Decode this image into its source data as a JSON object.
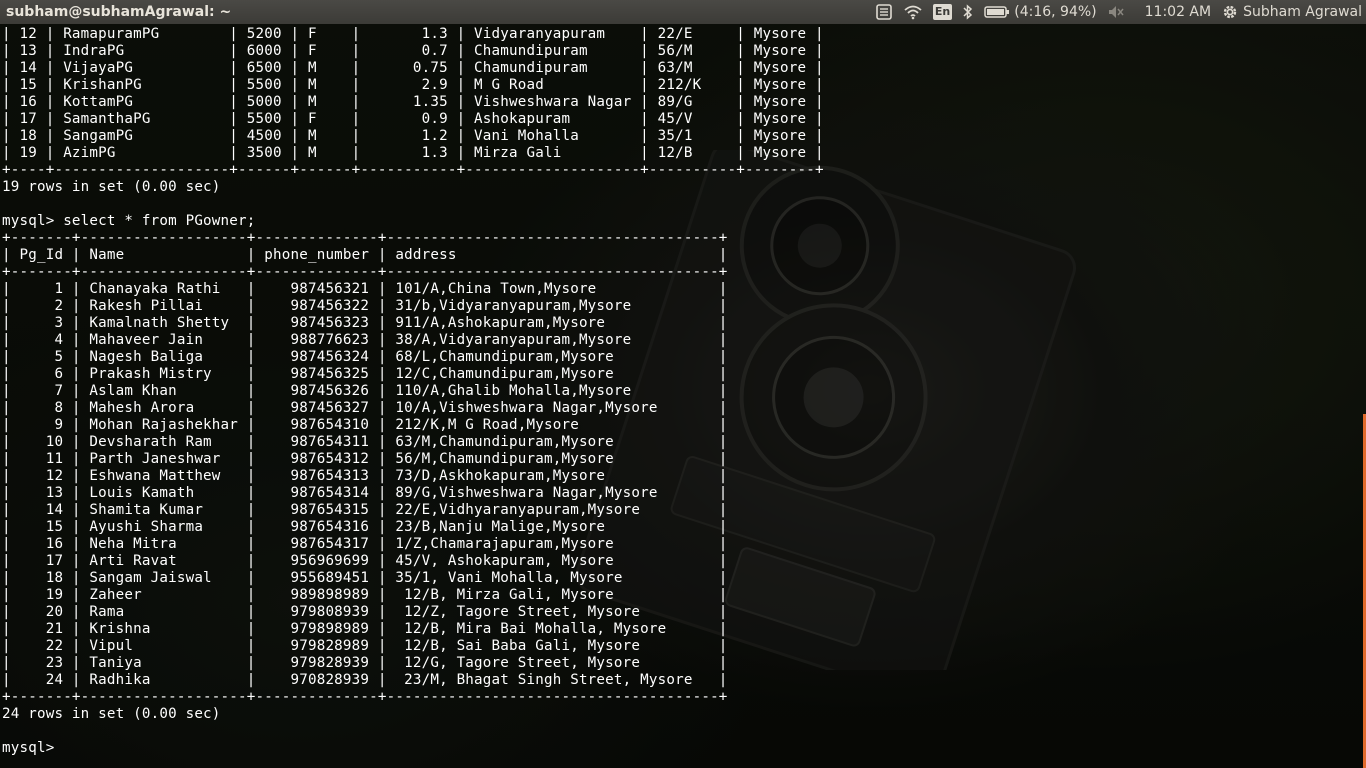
{
  "topbar": {
    "window_title": "subham@subhamAgrawal: ~",
    "language": "En",
    "battery": "(4:16, 94%)",
    "clock": "11:02 AM",
    "user": "Subham Agrawal"
  },
  "terminal": {
    "lines": [
      "| 12 | RamapuramPG        | 5200 | F    |       1.3 | Vidyaranyapuram    | 22/E     | Mysore |",
      "| 13 | IndraPG            | 6000 | F    |       0.7 | Chamundipuram      | 56/M     | Mysore |",
      "| 14 | VijayaPG           | 6500 | M    |      0.75 | Chamundipuram      | 63/M     | Mysore |",
      "| 15 | KrishanPG          | 5500 | M    |       2.9 | M G Road           | 212/K    | Mysore |",
      "| 16 | KottamPG           | 5000 | M    |      1.35 | Vishweshwara Nagar | 89/G     | Mysore |",
      "| 17 | SamanthaPG         | 5500 | F    |       0.9 | Ashokapuram        | 45/V     | Mysore |",
      "| 18 | SangamPG           | 4500 | M    |       1.2 | Vani Mohalla       | 35/1     | Mysore |",
      "| 19 | AzimPG             | 3500 | M    |       1.3 | Mirza Gali         | 12/B     | Mysore |",
      "+----+--------------------+------+------+-----------+--------------------+----------+--------+",
      "19 rows in set (0.00 sec)",
      "",
      "mysql> select * from PGowner;",
      "+-------+-------------------+--------------+--------------------------------------+",
      "| Pg_Id | Name              | phone_number | address                              |",
      "+-------+-------------------+--------------+--------------------------------------+",
      "|     1 | Chanayaka Rathi   |    987456321 | 101/A,China Town,Mysore              |",
      "|     2 | Rakesh Pillai     |    987456322 | 31/b,Vidyaranyapuram,Mysore          |",
      "|     3 | Kamalnath Shetty  |    987456323 | 911/A,Ashokapuram,Mysore             |",
      "|     4 | Mahaveer Jain     |    988776623 | 38/A,Vidyaranyapuram,Mysore          |",
      "|     5 | Nagesh Baliga     |    987456324 | 68/L,Chamundipuram,Mysore            |",
      "|     6 | Prakash Mistry    |    987456325 | 12/C,Chamundipuram,Mysore            |",
      "|     7 | Aslam Khan        |    987456326 | 110/A,Ghalib Mohalla,Mysore          |",
      "|     8 | Mahesh Arora      |    987456327 | 10/A,Vishweshwara Nagar,Mysore       |",
      "|     9 | Mohan Rajashekhar |    987654310 | 212/K,M G Road,Mysore                |",
      "|    10 | Devsharath Ram    |    987654311 | 63/M,Chamundipuram,Mysore            |",
      "|    11 | Parth Janeshwar   |    987654312 | 56/M,Chamundipuram,Mysore            |",
      "|    12 | Eshwana Matthew   |    987654313 | 73/D,Askhokapuram,Mysore             |",
      "|    13 | Louis Kamath      |    987654314 | 89/G,Vishweshwara Nagar,Mysore       |",
      "|    14 | Shamita Kumar     |    987654315 | 22/E,Vidhyaranyapuram,Mysore         |",
      "|    15 | Ayushi Sharma     |    987654316 | 23/B,Nanju Malige,Mysore             |",
      "|    16 | Neha Mitra        |    987654317 | 1/Z,Chamarajapuram,Mysore            |",
      "|    17 | Arti Ravat        |    956969699 | 45/V, Ashokapuram, Mysore            |",
      "|    18 | Sangam Jaiswal    |    955689451 | 35/1, Vani Mohalla, Mysore           |",
      "|    19 | Zaheer            |    989898989 |  12/B, Mirza Gali, Mysore            |",
      "|    20 | Rama              |    979808939 |  12/Z, Tagore Street, Mysore         |",
      "|    21 | Krishna           |    979898989 |  12/B, Mira Bai Mohalla, Mysore      |",
      "|    22 | Vipul             |    979828989 |  12/B, Sai Baba Gali, Mysore         |",
      "|    23 | Taniya            |    979828939 |  12/G, Tagore Street, Mysore         |",
      "|    24 | Radhika           |    970828939 |  23/M, Bhagat Singh Street, Mysore   |",
      "+-------+-------------------+--------------+--------------------------------------+",
      "24 rows in set (0.00 sec)",
      "",
      "mysql> "
    ]
  }
}
